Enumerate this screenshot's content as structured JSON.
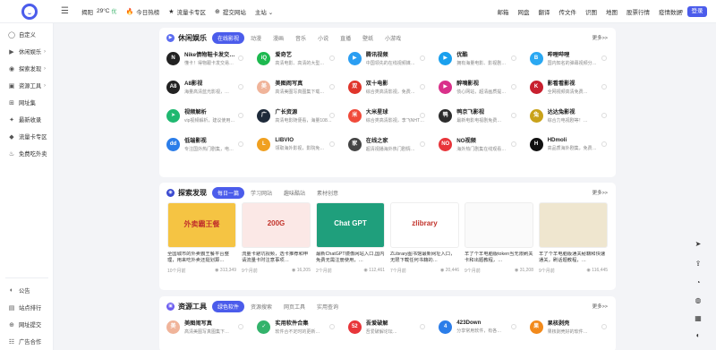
{
  "header": {
    "city": "揭阳",
    "temp": "29°C",
    "weather": "优",
    "quick_links": [
      {
        "icon": "flame-icon",
        "glyph": "🔥",
        "label": "今日热榜"
      },
      {
        "icon": "star-icon",
        "glyph": "★",
        "label": "流量卡专区"
      },
      {
        "icon": "upload-icon",
        "glyph": "⊕",
        "label": "提交网站"
      }
    ],
    "theme": "主站",
    "right_nav": [
      "邮箱",
      "网盘",
      "翻译",
      "传文件",
      "识图",
      "地图",
      "股票行情",
      "疫情数据"
    ],
    "login": "登录"
  },
  "sidebar": {
    "items": [
      {
        "label": "自定义",
        "glyph": "◯",
        "arrow": ""
      },
      {
        "label": "休闲娱乐",
        "glyph": "▶",
        "arrow": "›"
      },
      {
        "label": "探索发现",
        "glyph": "◉",
        "arrow": "›"
      },
      {
        "label": "资源工具",
        "glyph": "▣",
        "arrow": "›"
      },
      {
        "label": "网址集",
        "glyph": "⊞",
        "arrow": ""
      },
      {
        "label": "最新收录",
        "glyph": "✦",
        "arrow": ""
      },
      {
        "label": "流量卡专区",
        "glyph": "◆",
        "arrow": ""
      },
      {
        "label": "免费吃外卖",
        "glyph": "♨",
        "arrow": ""
      }
    ],
    "bottom": [
      {
        "label": "公告",
        "glyph": "◐"
      },
      {
        "label": "站点排行",
        "glyph": "▤"
      },
      {
        "label": "网址提交",
        "glyph": "⊕"
      },
      {
        "label": "广告合作",
        "glyph": "☷"
      }
    ]
  },
  "leisure": {
    "title": "休闲娱乐",
    "tabs": [
      "在线影视",
      "动漫",
      "漫画",
      "音乐",
      "小说",
      "直播",
      "壁纸",
      "小游戏"
    ],
    "more": "更多>>",
    "cards": [
      {
        "name": "Nike债物鞋卡发交…",
        "desc": "懂卡！得物跟卡发交易…",
        "color": "#222",
        "glyph": "N"
      },
      {
        "name": "爱奇艺",
        "desc": "高清电影、高清的大型…",
        "color": "#1db94f",
        "glyph": "iQ"
      },
      {
        "name": "腾讯视频",
        "desc": "中国领先的在线视频媒…",
        "color": "#2b9ef2",
        "glyph": "▶"
      },
      {
        "name": "优酷",
        "desc": "拥有海量电影、影视剧…",
        "color": "#1aa0ee",
        "glyph": "▶"
      },
      {
        "name": "哔哩哔哩",
        "desc": "国内知名的弹幕视频分…",
        "color": "#2aa8f2",
        "glyph": "B"
      },
      {
        "name": "A8影视",
        "desc": "海量高清蓝光影视，…",
        "color": "#222",
        "glyph": "A8"
      },
      {
        "name": "美图闹写真",
        "desc": "高清美图写真图集下载…",
        "color": "#f0b49a",
        "glyph": "美"
      },
      {
        "name": "双十电影",
        "desc": "综合类高清影视，免费…",
        "color": "#e0352b",
        "glyph": "双"
      },
      {
        "name": "醉嘀影视",
        "desc": "债心网站，超清画质提…",
        "color": "#d9308a",
        "glyph": "▶"
      },
      {
        "name": "影看看影视",
        "desc": "全网视频高清免费…",
        "color": "#c8202f",
        "glyph": "K"
      },
      {
        "name": "视频解析",
        "desc": "vip视频解析，建议使用…",
        "color": "#1fb870",
        "glyph": "➤"
      },
      {
        "name": "广长资源",
        "desc": "高清电影随便看，海量108…",
        "color": "#1e2a3a",
        "glyph": "广"
      },
      {
        "name": "大米星球",
        "desc": "综合类高清影视，李飞NHT…",
        "color": "#f04a3a",
        "glyph": "米"
      },
      {
        "name": "鸭京飞影视",
        "desc": "最新电影电视剧免费…",
        "color": "#2c2c2c",
        "glyph": "鸭"
      },
      {
        "name": "达达兔影视",
        "desc": "综合力电视剧等！…",
        "color": "#c9a21a",
        "glyph": "兔"
      },
      {
        "name": "低端影视",
        "desc": "专注国外热门剧集，电…",
        "color": "#2b7de9",
        "glyph": "dd"
      },
      {
        "name": "LIBVIO",
        "desc": "领取海外影视，影院免…",
        "color": "#f0a020",
        "glyph": "L"
      },
      {
        "name": "在线之家",
        "desc": "超清视播海外热门剧情…",
        "color": "#444",
        "glyph": "家"
      },
      {
        "name": "NO视频",
        "desc": "海外热门剧集在线观看…",
        "color": "#e8353a",
        "glyph": "NO"
      },
      {
        "name": "HDmoli",
        "desc": "高品质海外剧集，免费…",
        "color": "#111",
        "glyph": "H"
      }
    ]
  },
  "explore": {
    "title": "探索发现",
    "tabs": [
      "每日一篇",
      "学习网站",
      "趣味酷站",
      "素材创意"
    ],
    "more": "更多>>",
    "cards": [
      {
        "title": "全国城市的外卖霸王餐平台整理，用来吃外卖还挺划算…",
        "time": "10个月前",
        "views": "313,349",
        "bg": "#f5c443",
        "label": "外卖霸王餐"
      },
      {
        "title": "流量卡避坑视频，选卡推荐和申请流量卡时注意事项…",
        "time": "9个月前",
        "views": "16,205",
        "bg": "#fbe8e6",
        "label": "200G"
      },
      {
        "title": "最新ChatGPT镜像网站入口,国内免费无需注册使用，…",
        "time": "2个月前",
        "views": "112,461",
        "bg": "#1f9f7c",
        "label": "Chat GPT"
      },
      {
        "title": "ZLibrary图书馆最新网址入口，无限下载任何书籍的…",
        "time": "7个月前",
        "views": "20,446",
        "bg": "#ffffff",
        "label": "zlibrary"
      },
      {
        "title": "羊了个羊电脑版token当无限刷关卡和出题教程，…",
        "time": "9个月前",
        "views": "31,208",
        "bg": "#fafafa",
        "label": ""
      },
      {
        "title": "羊了个羊电脑版通关秘籍和快速通关，刷话题教程，…",
        "time": "9个月前",
        "views": "116,445",
        "bg": "#efe6cf",
        "label": ""
      }
    ]
  },
  "resources": {
    "title": "资源工具",
    "tabs": [
      "绿色软件",
      "资源搜索",
      "网页工具",
      "实用查询"
    ],
    "more": "更多>>",
    "cards": [
      {
        "name": "美图闹写真",
        "desc": "高清美图写真图集下…",
        "color": "#f0b49a",
        "glyph": "美"
      },
      {
        "name": "实用软件合集",
        "desc": "软件合不定时的更新…",
        "color": "#33b36b",
        "glyph": "✓"
      },
      {
        "name": "吾爱破解",
        "desc": "吾爱破解论坛…",
        "color": "#e8353a",
        "glyph": "52"
      },
      {
        "name": "423Down",
        "desc": "分享常用软件，有各…",
        "color": "#2b7de9",
        "glyph": "4"
      },
      {
        "name": "果核剥壳",
        "desc": "果核剥壳好的软件…",
        "color": "#f28a1c",
        "glyph": "果"
      }
    ]
  }
}
